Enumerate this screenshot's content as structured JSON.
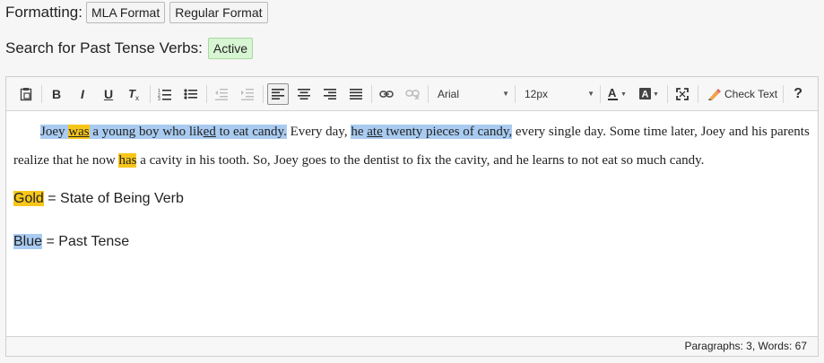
{
  "formatting": {
    "label": "Formatting:",
    "buttons": [
      "MLA Format",
      "Regular Format"
    ]
  },
  "search": {
    "label": "Search for Past Tense Verbs:",
    "status": "Active"
  },
  "toolbar": {
    "font_family": "Arial",
    "font_size": "12px",
    "check_text_label": "Check Text",
    "help_label": "?"
  },
  "content": {
    "paragraph1": [
      {
        "text": "Joey ",
        "hl": "blue"
      },
      {
        "text": "was",
        "hl": "gold",
        "u": true
      },
      {
        "text": " a young boy who lik",
        "hl": "blue"
      },
      {
        "text": "ed",
        "hl": "blue",
        "u": true
      },
      {
        "text": " to eat candy.",
        "hl": "blue"
      },
      {
        "text": " Every day, ",
        "hl": ""
      },
      {
        "text": " he ",
        "hl": "blue"
      },
      {
        "text": "ate",
        "hl": "blue",
        "u": true
      },
      {
        "text": " twenty pieces of candy,",
        "hl": "blue"
      },
      {
        "text": " every single day. Some time later, Joey and his parents realize that he now ",
        "hl": ""
      },
      {
        "text": "has",
        "hl": "gold"
      },
      {
        "text": " a cavity in his tooth. So, Joey goes to the dentist to fix the cavity, and he learns to not eat so much candy.",
        "hl": ""
      }
    ],
    "legend": [
      {
        "swatch": "Gold",
        "text": " = State of Being Verb",
        "hl": "gold"
      },
      {
        "swatch": "Blue",
        "text": " = Past Tense",
        "hl": "blue"
      }
    ]
  },
  "status_bar": {
    "text": "Paragraphs: 3, Words: 67"
  },
  "colors": {
    "gold_highlight": "#f7c61b",
    "blue_highlight": "#a9cbf1",
    "active_badge": "#d7f5d2"
  }
}
